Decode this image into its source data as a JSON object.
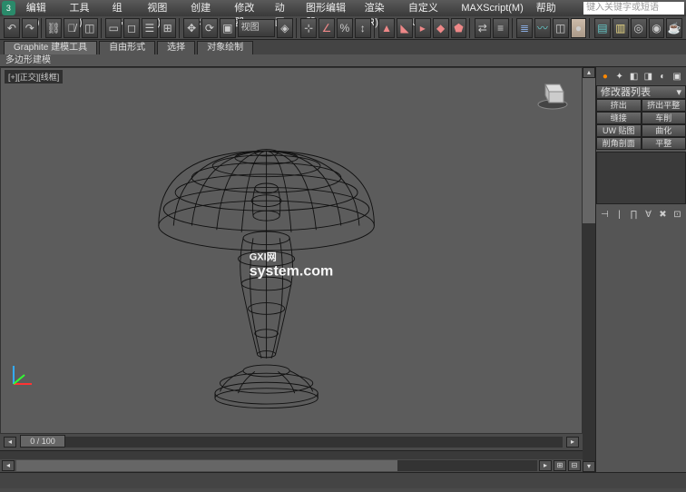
{
  "app_icon": "3",
  "menus": [
    "编辑(E)",
    "工具(T)",
    "组(G)",
    "视图(V)",
    "创建(C)",
    "修改器",
    "动画",
    "图形编辑器",
    "渲染(R)",
    "自定义(U)",
    "MAXScript(M)",
    "帮助(H)"
  ],
  "search_placeholder": "键入关键字或短语",
  "toolbar_dropdown": "视图",
  "ribbon": {
    "tabs": [
      "Graphite 建模工具",
      "自由形式",
      "选择",
      "对象绘制"
    ],
    "panel": "多边形建模"
  },
  "viewport": {
    "label": "[+][正交][线框]"
  },
  "timeline": {
    "frame_label": "0 / 100"
  },
  "sidepanel": {
    "header": "修改器列表",
    "buttons": [
      [
        "挤出",
        "挤出平整"
      ],
      [
        "缝接",
        "车削"
      ],
      [
        "UW 贴图",
        "曲化"
      ],
      [
        "削角剖面",
        "平整"
      ]
    ]
  },
  "watermark": {
    "big": "GXI网",
    "small": "system.com"
  }
}
